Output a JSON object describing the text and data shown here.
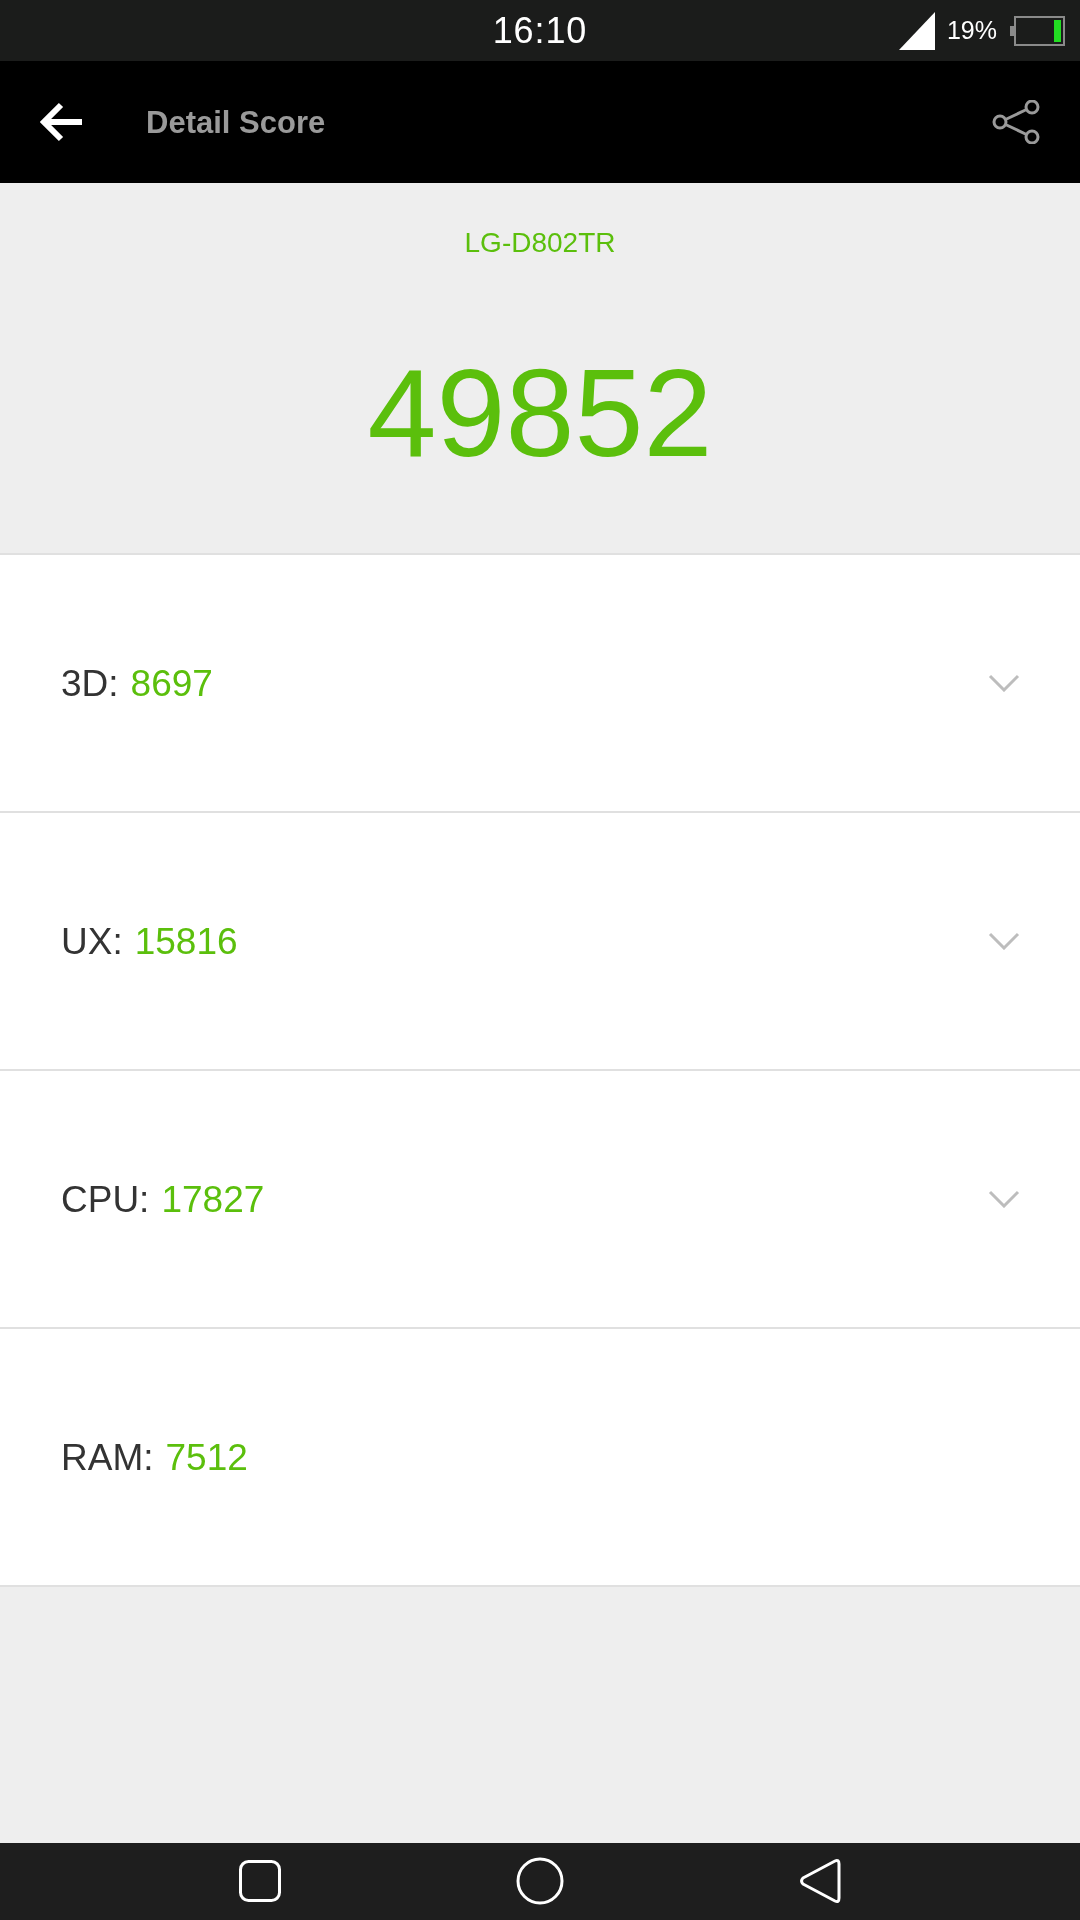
{
  "status_bar": {
    "time": "16:10",
    "battery_percent": "19%"
  },
  "toolbar": {
    "title": "Detail Score"
  },
  "summary": {
    "device": "LG-D802TR",
    "total_score": "49852"
  },
  "scores": [
    {
      "label": "3D:",
      "value": "8697",
      "expandable": true
    },
    {
      "label": "UX:",
      "value": "15816",
      "expandable": true
    },
    {
      "label": "CPU:",
      "value": "17827",
      "expandable": true
    },
    {
      "label": "RAM:",
      "value": "7512",
      "expandable": false
    }
  ]
}
